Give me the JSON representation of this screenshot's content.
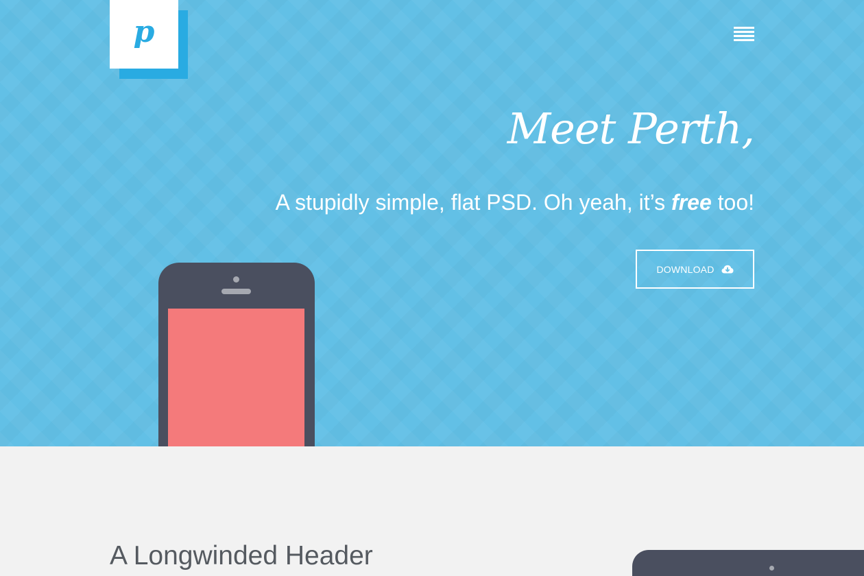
{
  "brand": {
    "logo_letter": "p"
  },
  "nav": {
    "menu_icon": "hamburger-menu-icon"
  },
  "hero": {
    "title": "Meet Perth,",
    "subtitle_before": "A stupidly simple, flat PSD. Oh yeah, it’s ",
    "subtitle_emphasis": "free",
    "subtitle_after": " too!",
    "download_label": "DOWNLOAD",
    "download_icon": "cloud-download-icon",
    "phone_illustration": "phone-illustration"
  },
  "section": {
    "header": "A Longwinded Header"
  },
  "colors": {
    "hero_background": "#62c0e6",
    "accent_blue": "#29abe2",
    "phone_body": "#4a4f5f",
    "phone_screen": "#f47a7b",
    "section_background": "#f2f2f2",
    "heading_text": "#555a60"
  }
}
